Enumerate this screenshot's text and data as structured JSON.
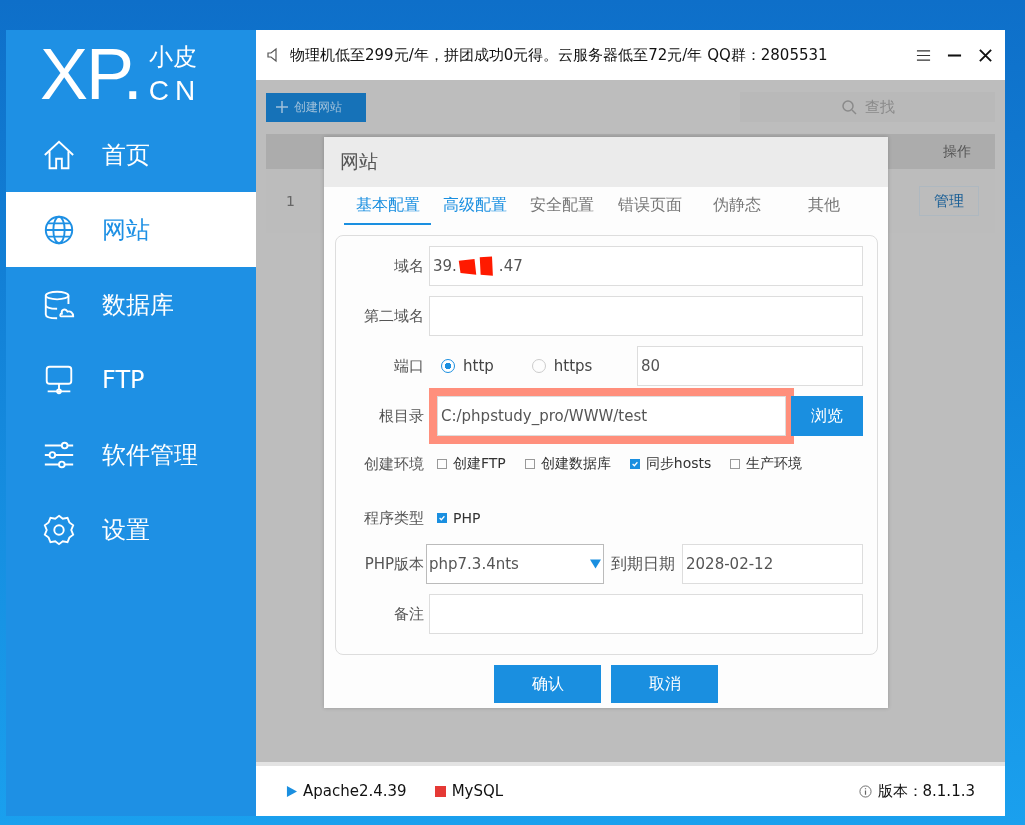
{
  "notice": "物理机低至299元/年，拼团成功0元得。云服务器低至72元/年  QQ群：2805531",
  "logo": {
    "mark": "XP.",
    "cn_name": "小皮",
    "suffix": "CN"
  },
  "sidebar": {
    "items": [
      {
        "label": "首页",
        "selected": false
      },
      {
        "label": "网站",
        "selected": true
      },
      {
        "label": "数据库",
        "selected": false
      },
      {
        "label": "FTP",
        "selected": false
      },
      {
        "label": "软件管理",
        "selected": false
      },
      {
        "label": "设置",
        "selected": false
      }
    ]
  },
  "toolbar": {
    "create_button": "创建网站",
    "search_placeholder": "查找"
  },
  "table": {
    "columns": [
      "操作"
    ],
    "rows": [
      {
        "index": "1",
        "action": "管理"
      }
    ]
  },
  "dialog": {
    "title": "网站",
    "tabs": [
      {
        "label": "基本配置",
        "selected": true,
        "hover": false
      },
      {
        "label": "高级配置",
        "selected": false,
        "hover": true
      },
      {
        "label": "安全配置",
        "selected": false,
        "hover": false
      },
      {
        "label": "错误页面",
        "selected": false,
        "hover": false
      },
      {
        "label": "伪静态",
        "selected": false,
        "hover": false
      },
      {
        "label": "其他",
        "selected": false,
        "hover": false
      }
    ],
    "domain": {
      "label": "域名",
      "value_start": "39.",
      "value_end": ".47",
      "redacted": true
    },
    "second_domain": {
      "label": "第二域名"
    },
    "port": {
      "label": "端口",
      "options": [
        {
          "label": "http",
          "selected": true
        },
        {
          "label": "https",
          "selected": false
        }
      ],
      "value": "80"
    },
    "root": {
      "label": "根目录",
      "value": "C:/phpstudy_pro/WWW/test",
      "highlighted": true,
      "browse_button": "浏览"
    },
    "environment": {
      "label": "创建环境",
      "options": [
        {
          "label": "创建FTP",
          "checked": false
        },
        {
          "label": "创建数据库",
          "checked": false
        },
        {
          "label": "同步hosts",
          "checked": true
        },
        {
          "label": "生产环境",
          "checked": false
        }
      ]
    },
    "program_type": {
      "label": "程序类型",
      "options": [
        {
          "label": "PHP",
          "checked": true
        }
      ]
    },
    "php_version": {
      "label": "PHP版本",
      "value": "php7.3.4nts"
    },
    "expiry": {
      "label": "到期日期",
      "value": "2028-02-12"
    },
    "notes": {
      "label": "备注"
    },
    "buttons": [
      "确认",
      "取消"
    ]
  },
  "status_bar": {
    "services": [
      {
        "name": "Apache2.4.39",
        "running": true
      },
      {
        "name": "MySQL",
        "running": false
      }
    ],
    "version": "版本：8.1.1.3"
  }
}
